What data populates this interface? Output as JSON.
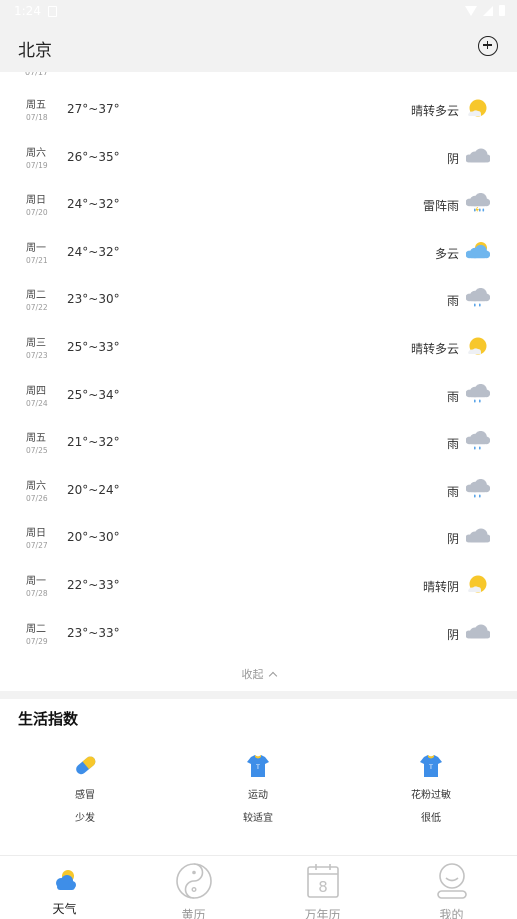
{
  "status_bar": {
    "time": "1:24"
  },
  "header": {
    "city": "北京"
  },
  "forecast": [
    {
      "day": "周五",
      "date": "07/18",
      "temp": "27°~37°",
      "cond": "晴转多云",
      "icon": "sun-cloud-icon"
    },
    {
      "day": "周六",
      "date": "07/19",
      "temp": "26°~35°",
      "cond": "阴",
      "icon": "overcast-icon"
    },
    {
      "day": "周日",
      "date": "07/20",
      "temp": "24°~32°",
      "cond": "雷阵雨",
      "icon": "thunder-rain-icon"
    },
    {
      "day": "周一",
      "date": "07/21",
      "temp": "24°~32°",
      "cond": "多云",
      "icon": "partly-cloudy-icon"
    },
    {
      "day": "周二",
      "date": "07/22",
      "temp": "23°~30°",
      "cond": "雨",
      "icon": "rain-icon"
    },
    {
      "day": "周三",
      "date": "07/23",
      "temp": "25°~33°",
      "cond": "晴转多云",
      "icon": "sun-cloud-icon"
    },
    {
      "day": "周四",
      "date": "07/24",
      "temp": "25°~34°",
      "cond": "雨",
      "icon": "rain-icon"
    },
    {
      "day": "周五",
      "date": "07/25",
      "temp": "21°~32°",
      "cond": "雨",
      "icon": "rain-icon"
    },
    {
      "day": "周六",
      "date": "07/26",
      "temp": "20°~24°",
      "cond": "雨",
      "icon": "rain-icon"
    },
    {
      "day": "周日",
      "date": "07/27",
      "temp": "20°~30°",
      "cond": "阴",
      "icon": "overcast-icon"
    },
    {
      "day": "周一",
      "date": "07/28",
      "temp": "22°~33°",
      "cond": "晴转阴",
      "icon": "sun-cloud-icon"
    },
    {
      "day": "周二",
      "date": "07/29",
      "temp": "23°~33°",
      "cond": "阴",
      "icon": "overcast-icon"
    }
  ],
  "collapse_label": "收起",
  "life": {
    "title": "生活指数",
    "items": [
      {
        "name": "感冒",
        "value": "少发",
        "icon": "pill-icon"
      },
      {
        "name": "运动",
        "value": "较适宜",
        "icon": "shirt-icon"
      },
      {
        "name": "花粉过敏",
        "value": "很低",
        "icon": "shirt-icon"
      }
    ]
  },
  "tabs": [
    {
      "label": "天气",
      "icon": "weather-icon",
      "active": true
    },
    {
      "label": "黄历",
      "icon": "yin-yang-icon",
      "active": false
    },
    {
      "label": "万年历",
      "icon": "calendar-icon",
      "active": false,
      "number": "8"
    },
    {
      "label": "我的",
      "icon": "profile-icon",
      "active": false
    }
  ],
  "colors": {
    "sun": "#f7c72b",
    "cloud": "#b8bec9",
    "rain": "#5aa4e8",
    "accent": "#3e8ee8",
    "bar_bg": "#f2f2f2"
  }
}
